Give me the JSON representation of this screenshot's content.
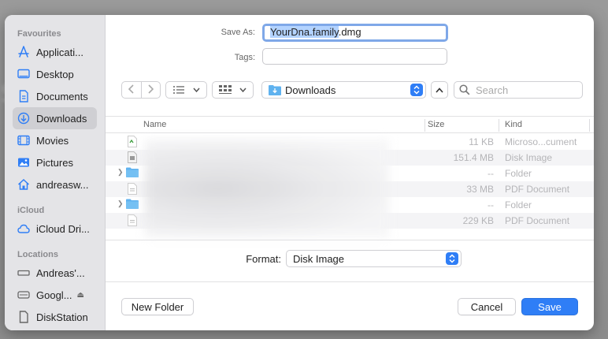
{
  "colors": {
    "accent": "#2f7ef6",
    "sidebar_bg": "#e4e4e7",
    "selected_row": "#cfcfd3",
    "text_selection": "#b3d3ff"
  },
  "sidebar": {
    "sections": [
      {
        "title": "Favourites",
        "items": [
          {
            "label": "Applicati...",
            "icon": "applications-icon"
          },
          {
            "label": "Desktop",
            "icon": "desktop-icon"
          },
          {
            "label": "Documents",
            "icon": "document-icon"
          },
          {
            "label": "Downloads",
            "icon": "downloads-icon",
            "selected": true
          },
          {
            "label": "Movies",
            "icon": "movies-icon"
          },
          {
            "label": "Pictures",
            "icon": "pictures-icon"
          },
          {
            "label": "andreasw...",
            "icon": "home-icon"
          }
        ]
      },
      {
        "title": "iCloud",
        "items": [
          {
            "label": "iCloud Dri...",
            "icon": "cloud-icon"
          }
        ]
      },
      {
        "title": "Locations",
        "items": [
          {
            "label": "Andreas'...",
            "icon": "laptop-icon"
          },
          {
            "label": "Googl...",
            "icon": "drive-icon",
            "eject": true
          },
          {
            "label": "DiskStation",
            "icon": "network-volume-icon"
          }
        ]
      }
    ]
  },
  "save_as": {
    "label": "Save As:",
    "selected_part": "YourDna.family",
    "rest": ".dmg"
  },
  "tags": {
    "label": "Tags:",
    "value": ""
  },
  "toolbar": {
    "location": "Downloads",
    "search_placeholder": "Search"
  },
  "list": {
    "columns": {
      "name": "Name",
      "size": "Size",
      "kind": "Kind"
    },
    "rows": [
      {
        "size": "11 KB",
        "kind": "Microso...cument",
        "icon": "word-doc-icon",
        "folder": false
      },
      {
        "size": "151.4 MB",
        "kind": "Disk Image",
        "icon": "disk-image-icon",
        "folder": false
      },
      {
        "size": "--",
        "kind": "Folder",
        "icon": "folder-icon",
        "folder": true
      },
      {
        "size": "33 MB",
        "kind": "PDF Document",
        "icon": "pdf-icon",
        "folder": false
      },
      {
        "size": "--",
        "kind": "Folder",
        "icon": "folder-icon",
        "folder": true
      },
      {
        "size": "229 KB",
        "kind": "PDF Document",
        "icon": "pdf-icon",
        "folder": false
      }
    ]
  },
  "format": {
    "label": "Format:",
    "value": "Disk Image"
  },
  "buttons": {
    "new_folder": "New Folder",
    "cancel": "Cancel",
    "save": "Save"
  }
}
